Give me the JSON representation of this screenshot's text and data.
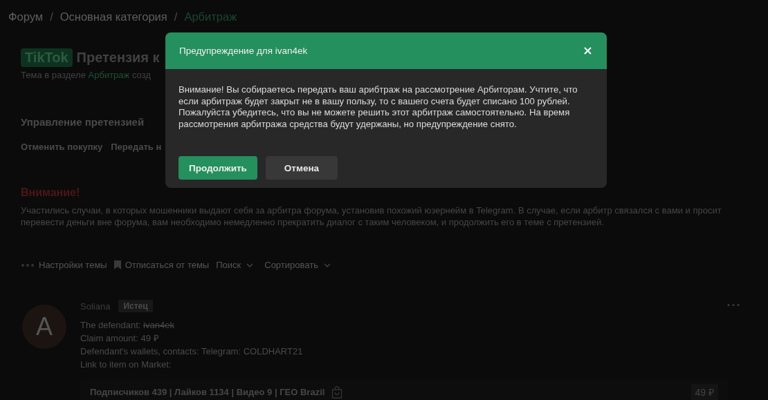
{
  "breadcrumb_separator": "/",
  "breadcrumb": [
    {
      "label": "Форум",
      "current": false
    },
    {
      "label": "Основная категория",
      "current": false
    },
    {
      "label": "Арбитраж",
      "current": true
    }
  ],
  "thread": {
    "prefix": "TikTok",
    "title": "Претензия к",
    "subtitle": "Тема в разделе",
    "section_link": "Арбитраж",
    "subtitle_rest": "созд"
  },
  "claim_management": {
    "title": "Управление претензией",
    "actions": [
      "Отменить покупку",
      "Передать н"
    ]
  },
  "notice": {
    "title": "Внимание!",
    "text": "Участились случаи, в которых мошенники выдают себя за арбитра форума, установив похожий юзернейм в Telegram. В случае, если арбитр связался с вами и просит перевести деньги вне форума, вам необходимо немедленно прекратить диалог с таким человеком, и продолжить его в теме с претензией."
  },
  "toolbar": [
    {
      "label": "Настройки темы",
      "kind": "dots"
    },
    {
      "label": "Отписаться от темы",
      "kind": "bookmark"
    },
    {
      "label": "Поиск",
      "kind": "dropdown"
    },
    {
      "label": "Сортировать",
      "kind": "dropdown"
    }
  ],
  "post": {
    "avatar_letter": "A",
    "author": "Soliana",
    "role": "Истец",
    "lines": [
      {
        "label": "The defendant:",
        "value": "ivan4ek",
        "struck": true
      },
      {
        "label": "Claim amount:",
        "value": "49 ₽",
        "struck": false
      },
      {
        "label": "Defendant's wallets, contacts:",
        "value": "Telegram: COLDHART21",
        "struck": false
      },
      {
        "label": "Link to item on Market:",
        "struck": false
      }
    ],
    "item": {
      "text": "Подписчиков 439 | Лайков 1134 | Видео 9 | ГЕО Brazil",
      "price": "49 ₽"
    }
  },
  "modal": {
    "title": "Предупреждение для ivan4ek",
    "body": "Внимание! Вы собираетесь передать ваш арибтраж на рассмотрение Арбиторам. Учтите, что если арбитраж будет закрыт не в вашу пользу, то с вашего счета будет списано 100 рублей. Пожалуйста убедитесь, что вы не можете решить этот арбитраж самостоятельно. На время рассмотрения арбитража средства будут удержаны, но предупреждение снято.",
    "buttons": [
      {
        "label": "Продолжить",
        "kind": "primary"
      },
      {
        "label": "Отмена",
        "kind": "secondary"
      }
    ]
  }
}
